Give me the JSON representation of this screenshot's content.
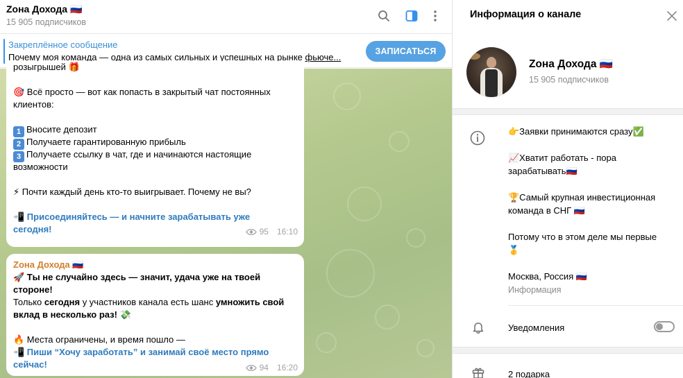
{
  "chat": {
    "title": "Zона Дохода 🇷🇺",
    "subscribers": "15 905 подписчиков",
    "pinned_title": "Закреплённое сообщение",
    "pinned_text_prefix": "Почему моя команда — одна из самых сильных и успешных на рынке ",
    "pinned_text_link": "фьюче...",
    "join_button": "ЗАПИСАТЬСЯ"
  },
  "message1": {
    "line_top": "розыгрышей 🎁",
    "line_a1": "🎯 Всё просто — вот как попасть в закрытый чат постоянных",
    "line_a2": "клиентов:",
    "step1": "Вносите депозит",
    "step2": "Получаете гарантированную прибыль",
    "step3a": "Получаете ссылку в чат, где и начинаются настоящие",
    "step3b": "возможности",
    "line_b": "⚡ Почти каждый день кто-то выигрывает. Почему не вы?",
    "link1": "📲 Присоединяйтесь — и начните зарабатывать уже",
    "link2": "сегодня!",
    "views": "95",
    "time": "16:10"
  },
  "message2": {
    "sender": "Zона Дохода 🇷🇺",
    "l1": "🚀 Ты не случайно здесь — значит, удача уже на твоей",
    "l2": "стороне!",
    "l3_a": "Только ",
    "l3_b": "сегодня",
    "l3_c": " у участников канала есть шанс ",
    "l3_d": "умножить свой",
    "l4": "вклад в несколько раз! 💸",
    "l5": "🔥 Места ограничены, и время пошло —",
    "l6": "📲 Пиши “Хочу заработать” и занимай своё место прямо",
    "l7": "сейчас!",
    "views": "94",
    "time": "16:20"
  },
  "info": {
    "title": "Информация о канале",
    "name": "Zона Дохода 🇷🇺",
    "subscribers": "15 905 подписчиков",
    "desc1": "👉Заявки принимаются сразу✅",
    "desc2a": "📈Хватит работать - пора",
    "desc2b": "зарабатывать🇷🇺",
    "desc3a": "🏆Самый крупная инвестиционная",
    "desc3b": "команда в СНГ 🇷🇺",
    "desc4a": "Потому что в этом деле мы первые",
    "desc4b": "🥇",
    "desc5": "Москва, Россия 🇷🇺",
    "desc_label": "Информация",
    "notifications": "Уведомления",
    "notifications_on": false,
    "gifts": "2 подарка"
  },
  "colors": {
    "accent": "#3390ec",
    "join_button": "#56a2e3",
    "link": "#2f7bbd",
    "sender": "#d0802a"
  }
}
